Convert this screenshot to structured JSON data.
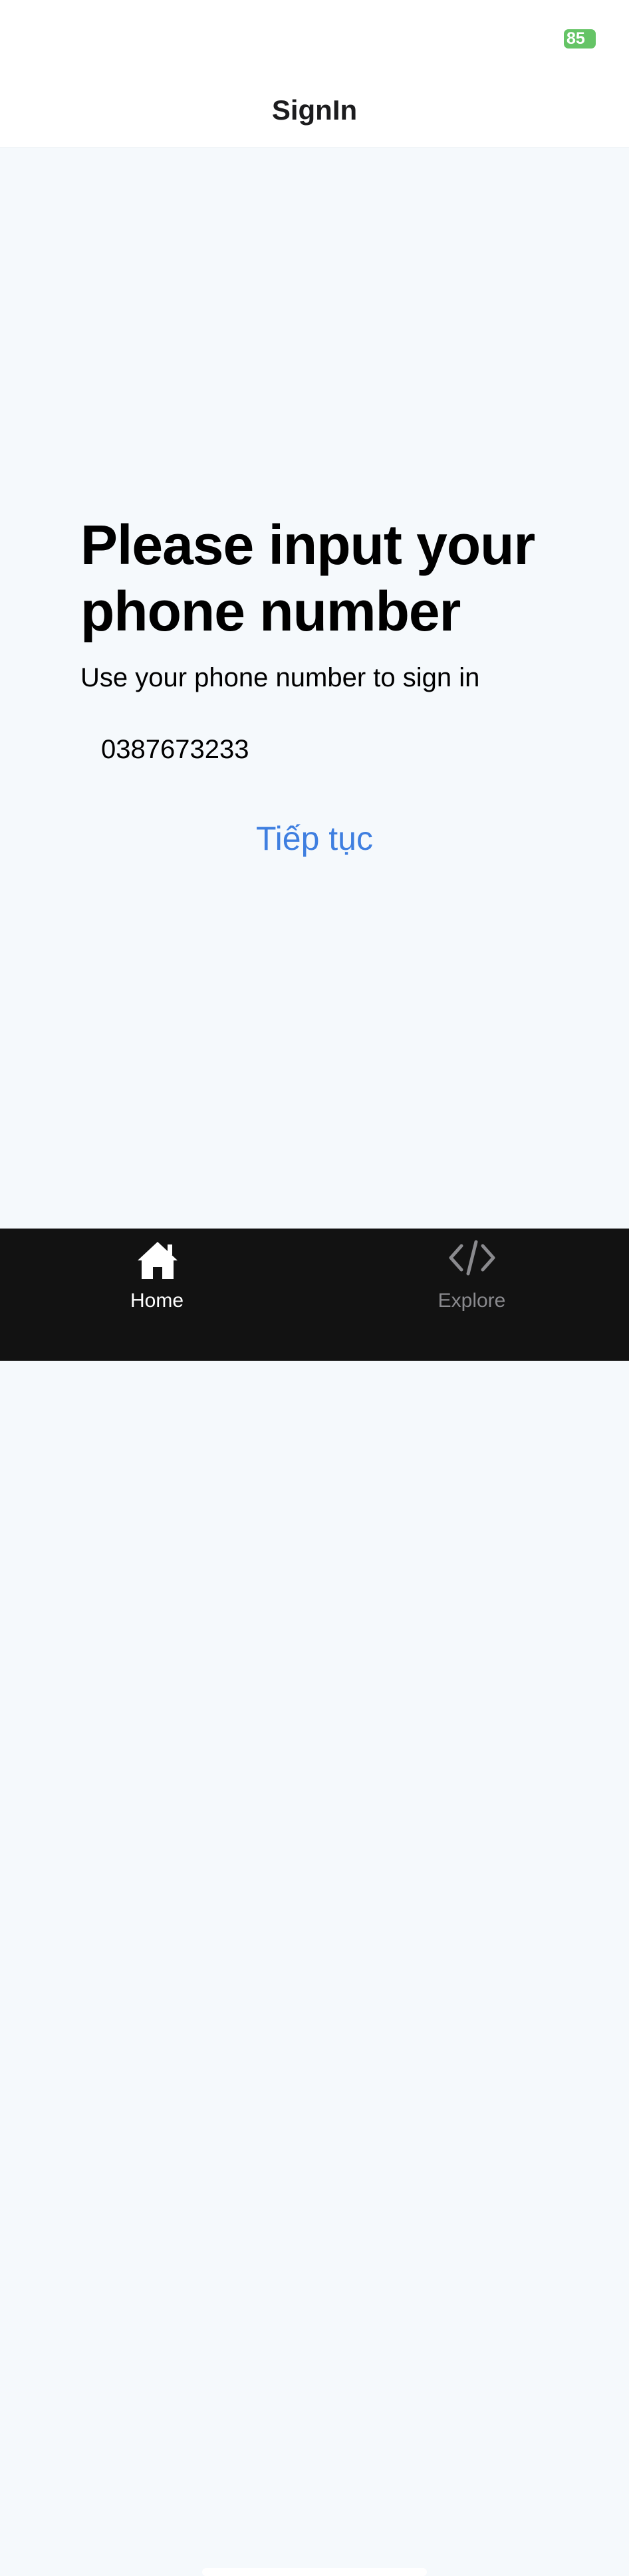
{
  "status_bar": {
    "battery": "85"
  },
  "nav": {
    "title": "SignIn"
  },
  "form": {
    "headline": "Please input your phone number",
    "subtitle": "Use your phone number to sign in",
    "phone_value": "0387673233",
    "continue_label": "Tiếp tục"
  },
  "tabs": [
    {
      "label": "Home",
      "icon": "home-icon",
      "active": true
    },
    {
      "label": "Explore",
      "icon": "code-icon",
      "active": false
    }
  ],
  "colors": {
    "accent": "#3f7fe0",
    "battery": "#65c466",
    "tab_bar": "#121212",
    "background": "#f5f9fc"
  }
}
